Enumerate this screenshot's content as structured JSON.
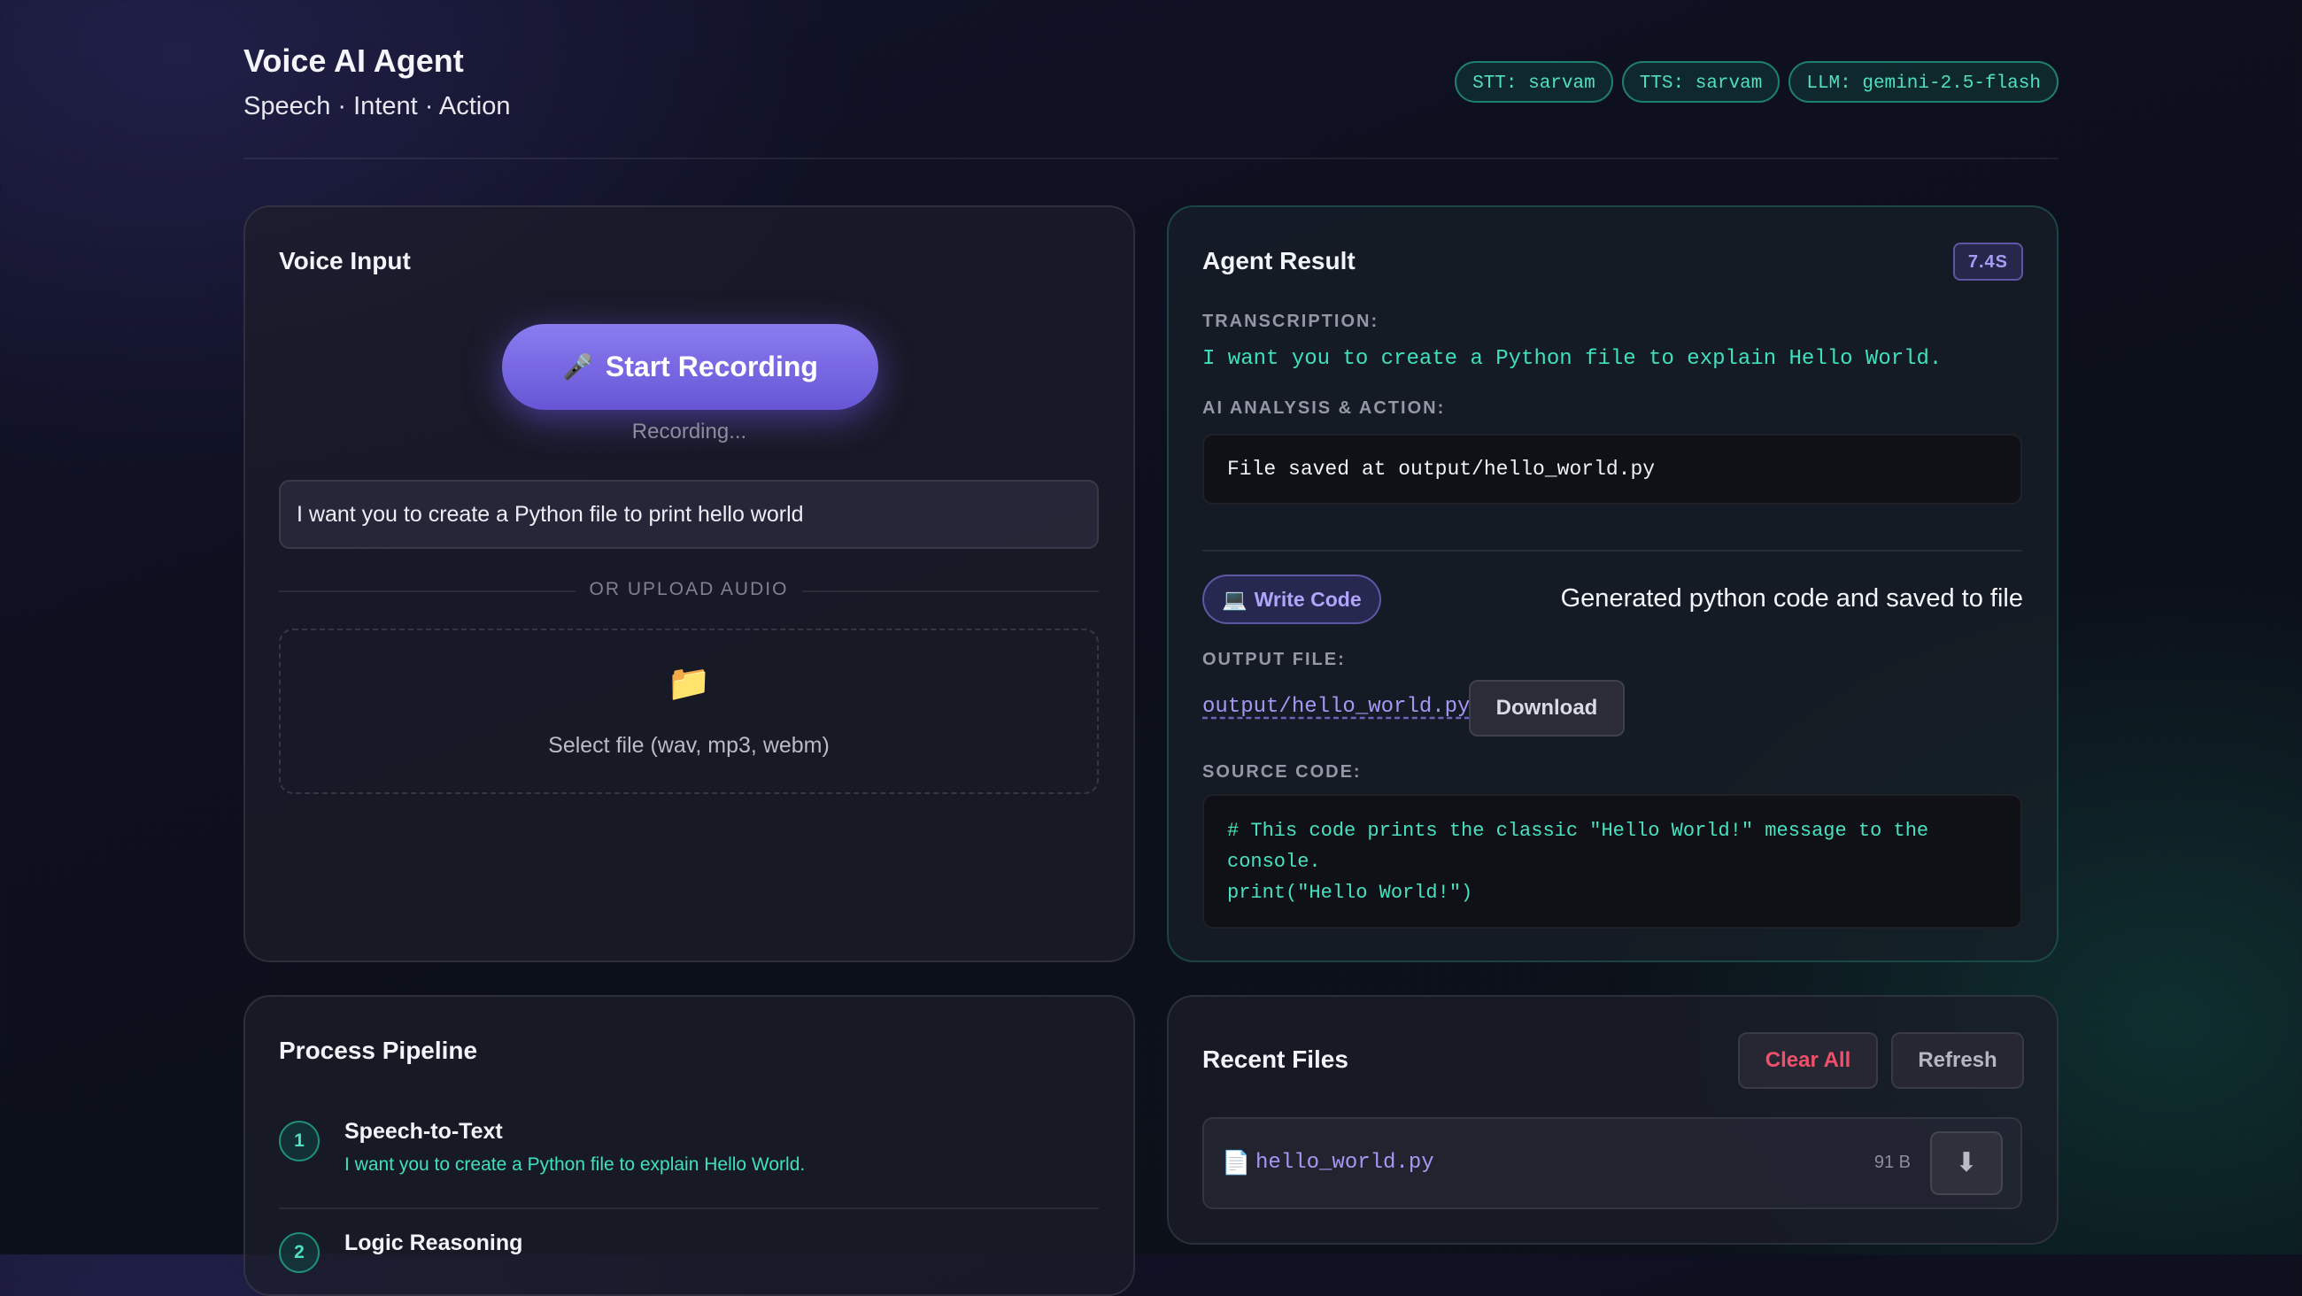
{
  "header": {
    "title": "Voice AI Agent",
    "subtitle": "Speech · Intent · Action",
    "badges": [
      "STT: sarvam",
      "TTS: sarvam",
      "LLM: gemini-2.5-flash"
    ]
  },
  "voice_input": {
    "title": "Voice Input",
    "record_icon": "🎤",
    "record_label": "Start Recording",
    "status": "Recording...",
    "transcript": "I want you to create a Python file to print hello world",
    "or_upload": "OR UPLOAD AUDIO",
    "upload_icon": "📁",
    "upload_text": "Select file (wav, mp3, webm)"
  },
  "agent_result": {
    "title": "Agent Result",
    "elapsed": "7.4S",
    "transcription_label": "TRANSCRIPTION:",
    "transcription": "I want you to create a Python file to explain Hello World.",
    "analysis_label": "AI ANALYSIS & ACTION:",
    "analysis": "File saved at output/hello_world.py",
    "intent_icon": "💻",
    "intent_label": "Write Code",
    "intent_description": "Generated python code and saved to file",
    "output_file_label": "OUTPUT FILE:",
    "output_file": "output/hello_world.py",
    "download_label": "Download",
    "source_code_label": "SOURCE CODE:",
    "source_code": "# This code prints the classic \"Hello World!\" message to the\nconsole.\nprint(\"Hello World!\")"
  },
  "pipeline": {
    "title": "Process Pipeline",
    "steps": [
      {
        "number": "1",
        "title": "Speech-to-Text",
        "detail": "I want you to create a Python file to explain Hello World."
      },
      {
        "number": "2",
        "title": "Logic Reasoning"
      }
    ]
  },
  "recent_files": {
    "title": "Recent Files",
    "clear_label": "Clear All",
    "refresh_label": "Refresh",
    "files": [
      {
        "icon": "📄",
        "name": "hello_world.py",
        "size": "91 B",
        "download_icon": "⬇"
      }
    ]
  },
  "colors": {
    "accent_purple": "#7b6be6",
    "accent_teal": "#3fe0bd",
    "danger": "#f0506a"
  }
}
